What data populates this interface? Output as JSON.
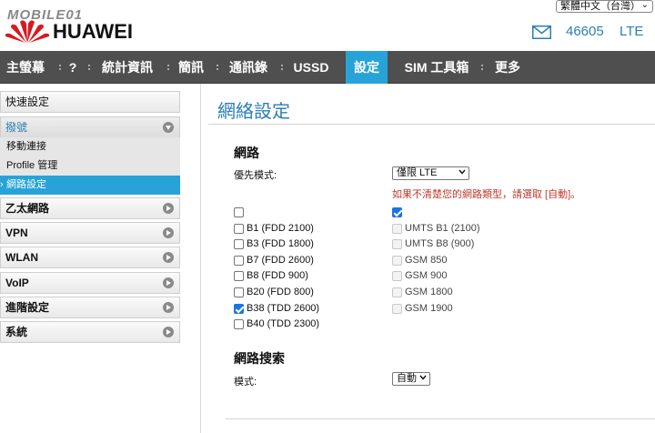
{
  "header": {
    "logo_top_text": "MOBILE01",
    "brand": "HUAWEI",
    "language": "繁體中文（台灣）",
    "operator": "46605",
    "network_type": "LTE"
  },
  "nav": {
    "items": [
      {
        "label": "主螢幕"
      },
      {
        "label": "?"
      },
      {
        "label": "統計資訊"
      },
      {
        "label": "簡訊"
      },
      {
        "label": "通訊錄"
      },
      {
        "label": "USSD"
      },
      {
        "label": "設定",
        "active": true
      },
      {
        "label": "SIM 工具箱"
      },
      {
        "label": "更多"
      }
    ]
  },
  "sidebar": {
    "items": [
      {
        "label": "快速設定"
      },
      {
        "label": "撥號",
        "expanded": true
      },
      {
        "label": "移動連接"
      },
      {
        "label": "Profile 管理"
      },
      {
        "label": "網路設定",
        "active": true
      },
      {
        "label": "乙太網路"
      },
      {
        "label": "VPN"
      },
      {
        "label": "WLAN"
      },
      {
        "label": "VoIP"
      },
      {
        "label": "進階設定"
      },
      {
        "label": "系統"
      }
    ]
  },
  "main": {
    "title": "網絡設定",
    "network_section": {
      "title": "網路",
      "preferred_mode_label": "優先模式:",
      "preferred_mode_value": "僅限 LTE",
      "warning": "如果不清楚您的網路類型，請選取 [自動]。",
      "lte_bands": [
        {
          "label": "B1 (FDD 2100)",
          "checked": false
        },
        {
          "label": "B3 (FDD 1800)",
          "checked": false
        },
        {
          "label": "B7 (FDD 2600)",
          "checked": false
        },
        {
          "label": "B8 (FDD 900)",
          "checked": false
        },
        {
          "label": "B20 (FDD 800)",
          "checked": false
        },
        {
          "label": "B38 (TDD 2600)",
          "checked": true
        },
        {
          "label": "B40 (TDD 2300)",
          "checked": false
        }
      ],
      "other_bands": [
        {
          "label": "UMTS B1 (2100)"
        },
        {
          "label": "UMTS B8 (900)"
        },
        {
          "label": "GSM 850"
        },
        {
          "label": "GSM 900"
        },
        {
          "label": "GSM 1800"
        },
        {
          "label": "GSM 1900"
        }
      ]
    },
    "search_section": {
      "title": "網路搜索",
      "mode_label": "模式:",
      "mode_value": "自動"
    }
  },
  "colors": {
    "accent": "#27a3d8",
    "nav_bg": "#4f4f4f",
    "warning": "#c0392b",
    "link_blue": "#2a7fb5"
  }
}
